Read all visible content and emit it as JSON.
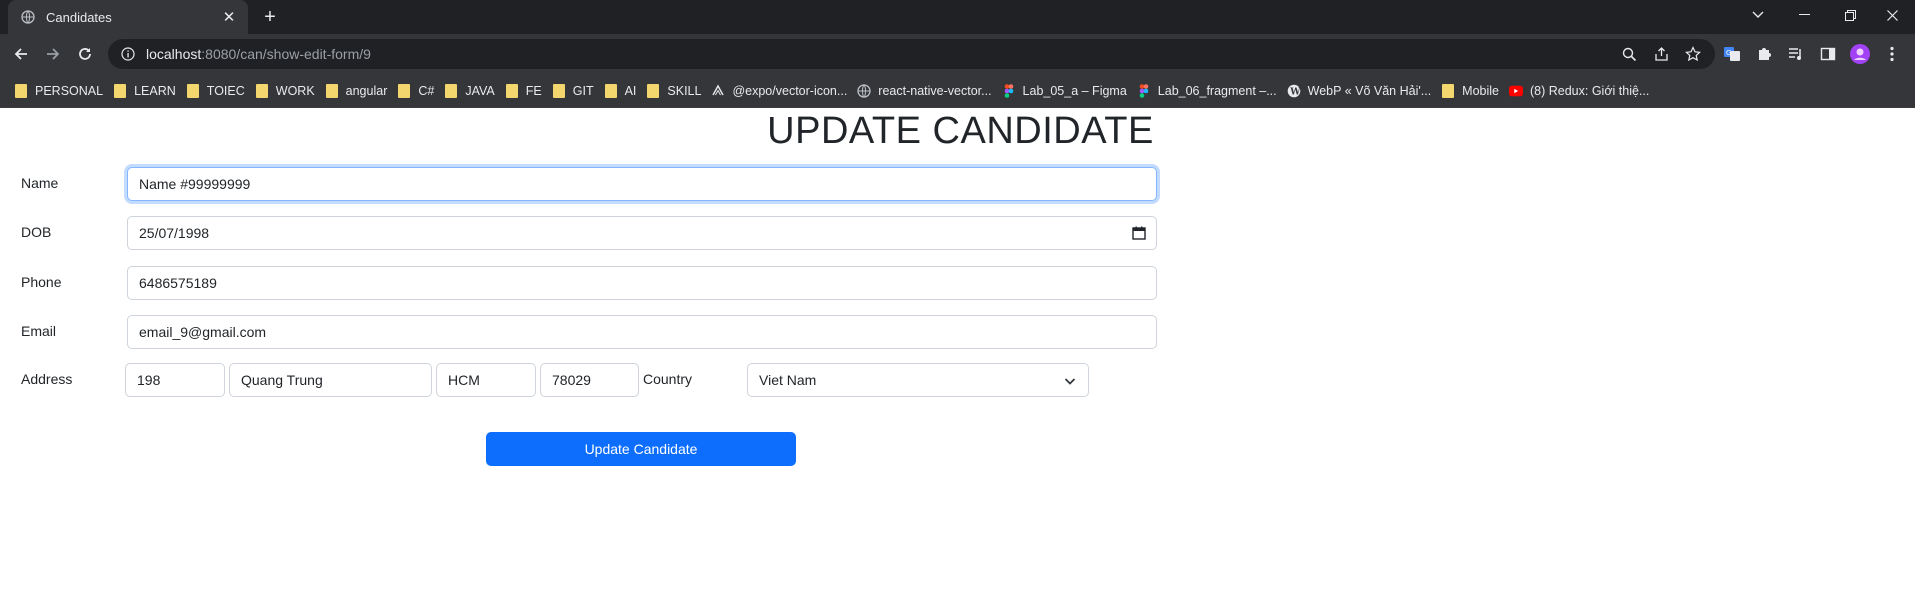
{
  "browser": {
    "tab_title": "Candidates",
    "url_host": "localhost",
    "url_rest": ":8080/can/show-edit-form/9",
    "bookmarks": [
      {
        "label": "PERSONAL",
        "icon": "folder-icon"
      },
      {
        "label": "LEARN",
        "icon": "folder-icon"
      },
      {
        "label": "TOIEC",
        "icon": "folder-icon"
      },
      {
        "label": "WORK",
        "icon": "folder-icon"
      },
      {
        "label": "angular",
        "icon": "folder-icon"
      },
      {
        "label": "C#",
        "icon": "folder-icon"
      },
      {
        "label": "JAVA",
        "icon": "folder-icon"
      },
      {
        "label": "FE",
        "icon": "folder-icon"
      },
      {
        "label": "GIT",
        "icon": "folder-icon"
      },
      {
        "label": "AI",
        "icon": "folder-icon"
      },
      {
        "label": "SKILL",
        "icon": "folder-icon"
      },
      {
        "label": "@expo/vector-icon...",
        "icon": "expo-icon"
      },
      {
        "label": "react-native-vector...",
        "icon": "globe-icon"
      },
      {
        "label": "Lab_05_a – Figma",
        "icon": "figma-icon"
      },
      {
        "label": "Lab_06_fragment –...",
        "icon": "figma-icon"
      },
      {
        "label": "WebP « Võ Văn Hải'...",
        "icon": "wordpress-icon"
      },
      {
        "label": "Mobile",
        "icon": "folder-icon"
      },
      {
        "label": "(8) Redux: Giới thiệ...",
        "icon": "youtube-icon"
      }
    ]
  },
  "page": {
    "heading": "UPDATE CANDIDATE",
    "labels": {
      "name": "Name",
      "dob": "DOB",
      "phone": "Phone",
      "email": "Email",
      "address": "Address",
      "country": "Country"
    },
    "values": {
      "name": "Name #99999999",
      "dob": "25/07/1998",
      "phone": "6486575189",
      "email": "email_9@gmail.com",
      "street_number": "198",
      "street": "Quang Trung",
      "city": "HCM",
      "zip": "78029",
      "country": "Viet Nam"
    },
    "submit_label": "Update Candidate"
  },
  "colors": {
    "primary": "#0d6efd",
    "focus_border": "#86b7fe",
    "text": "#212529"
  }
}
